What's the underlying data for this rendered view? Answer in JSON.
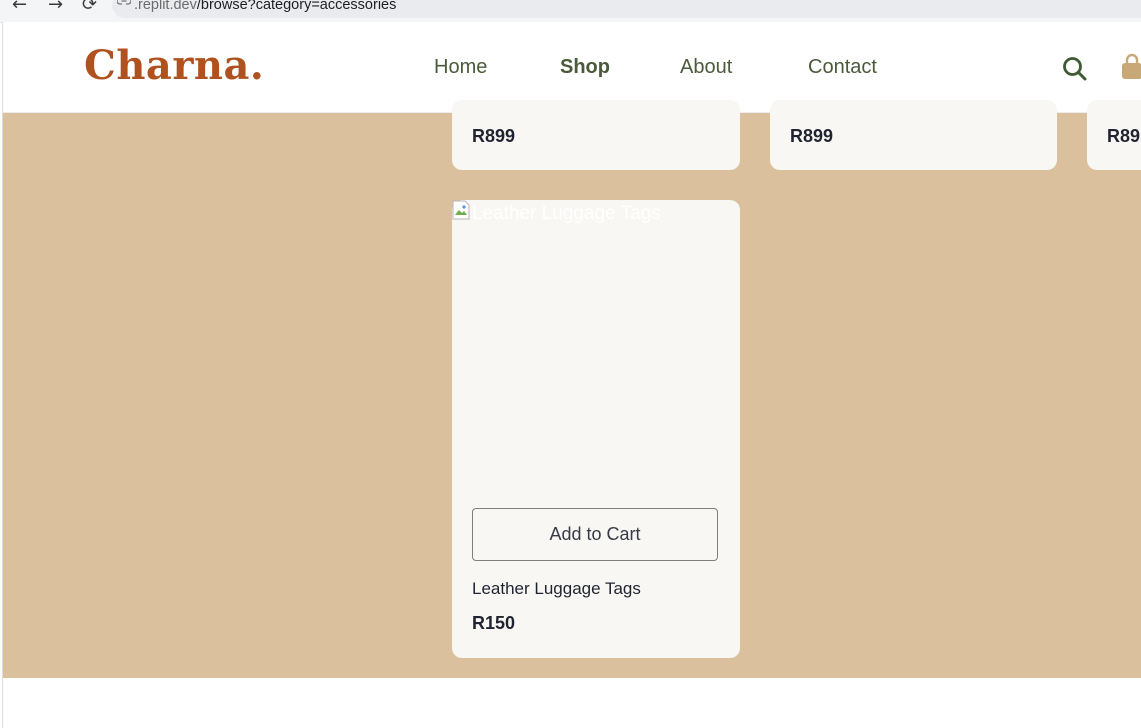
{
  "browser": {
    "back_icon": "←",
    "forward_icon": "→",
    "reload_icon": "⟳",
    "url_host": ".replit.dev",
    "url_path": "/browse?category=accessories"
  },
  "header": {
    "logo": "Charna.",
    "nav": [
      "Home",
      "Shop",
      "About",
      "Contact"
    ],
    "active_nav": "Shop"
  },
  "top_row_cards": [
    {
      "price": "R899"
    },
    {
      "price": "R899"
    },
    {
      "price": "R89"
    }
  ],
  "product_card": {
    "image_alt": "Leather Luggage Tags",
    "add_to_cart_label": "Add to Cart",
    "name": "Leather Luggage Tags",
    "price": "R150"
  },
  "colors": {
    "brand": "#b0521f",
    "nav_text": "#4a5a3b",
    "page_bg": "#dbc09d",
    "card_bg": "#f9f7f3",
    "bag_icon": "#c9a877"
  }
}
